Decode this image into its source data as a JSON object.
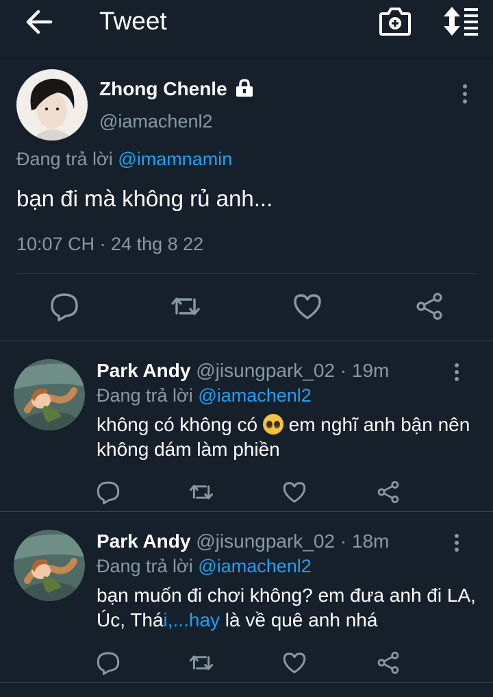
{
  "header": {
    "title": "Tweet"
  },
  "main_tweet": {
    "name": "Zhong Chenle",
    "handle": "@iamachenl2",
    "replying_label": "Đang trả lời",
    "replying_to": "@imamnamin",
    "text": "bạn đi mà không rủ anh...",
    "timestamp": "10:07 CH · 24 thg 8 22"
  },
  "replies": [
    {
      "name": "Park Andy",
      "meta": "@jisungpark_02 · 19m",
      "replying_label": "Đang trả lời",
      "replying_to": "@iamachenl2",
      "text_part1": "không có không có",
      "text_part2": "em nghĩ anh bận nên không dám làm phiền"
    },
    {
      "name": "Park Andy",
      "meta": "@jisungpark_02 · 18m",
      "replying_label": "Đang trả lời",
      "replying_to": "@iamachenl2",
      "text_part1": "bạn muốn đi chơi không? em đưa anh đi LA, Úc, Thá",
      "text_link": "i,...hay",
      "text_part2": " là về quê anh nhá"
    }
  ],
  "icons": {
    "back": "arrow-left-icon",
    "camera": "camera-add-icon",
    "sort": "sort-icon",
    "lock": "lock-icon",
    "more": "more-vertical-icon",
    "reply": "reply-icon",
    "retweet": "retweet-icon",
    "like": "heart-icon",
    "share": "share-icon",
    "emoji": "pleading-face-emoji"
  },
  "colors": {
    "background": "#15202b",
    "accent": "#1da1f2",
    "muted": "#8899a6",
    "divider": "#38444d"
  }
}
